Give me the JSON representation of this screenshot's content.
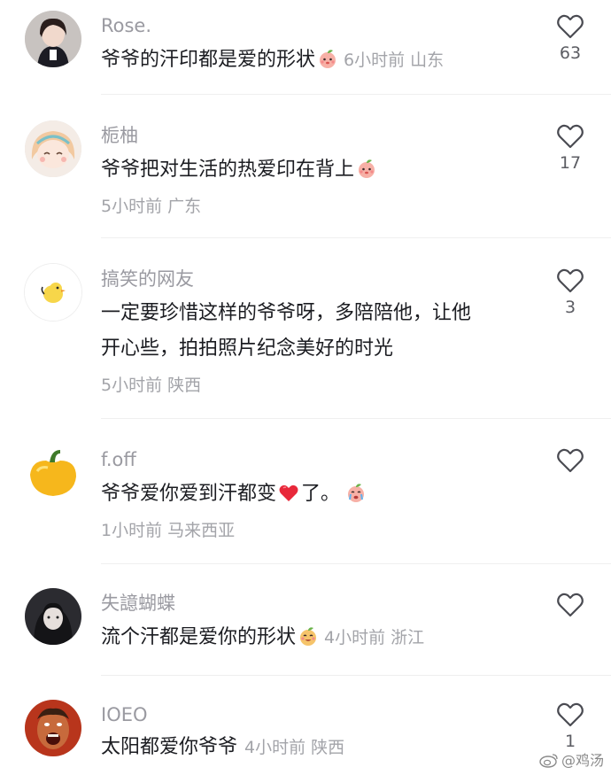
{
  "comments": [
    {
      "username": "Rose.",
      "text": "爷爷的汗印都是爱的形状",
      "emoji": "peach-face-emoji",
      "time": "6小时前",
      "location": "山东",
      "likes": "63"
    },
    {
      "username": "栀柚",
      "text": "爷爷把对生活的热爱印在背上",
      "emoji": "peach-face-emoji",
      "time": "5小时前",
      "location": "广东",
      "likes": "17"
    },
    {
      "username": "搞笑的网友",
      "text_line1": "一定要珍惜这样的爷爷呀，多陪陪他，让他",
      "text_line2": "开心些，拍拍照片纪念美好的时光",
      "time": "5小时前",
      "location": "陕西",
      "likes": "3"
    },
    {
      "username": "f.off",
      "text_a": "爷爷爱你爱到汗都变",
      "text_b": "了。",
      "emoji": "crying-peach-emoji",
      "time": "1小时前",
      "location": "马来西亚",
      "likes": ""
    },
    {
      "username": "失譩蝴蝶",
      "text": "流个汗都是爱你的形状",
      "emoji": "smile-peach-emoji",
      "time": "4小时前",
      "location": "浙江",
      "likes": ""
    },
    {
      "username": "IOEO",
      "text": "太阳都爱你爷爷",
      "time": "4小时前",
      "location": "陕西",
      "likes": "1"
    }
  ],
  "watermark": "@鸡汤",
  "colors": {
    "username": "#9a9aa1",
    "meta": "#a3a4a9",
    "text": "#1b1c21",
    "heart_outline": "#4a4b52",
    "red_heart": "#e8283a"
  }
}
